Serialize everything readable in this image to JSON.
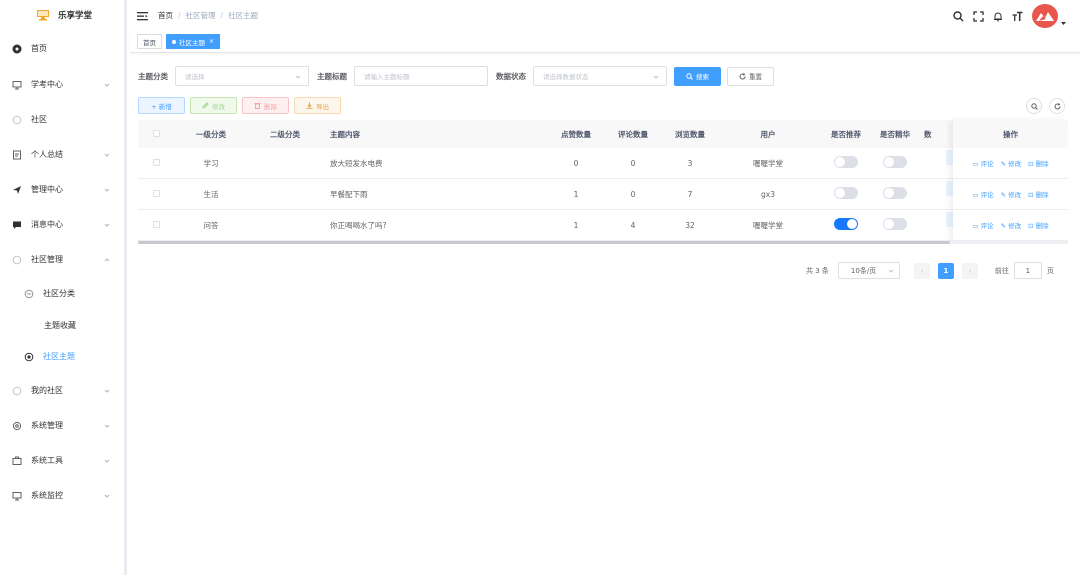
{
  "app": {
    "title": "乐享学堂"
  },
  "sidebar": {
    "items": [
      {
        "label": "首页",
        "icon": "dashboard-icon"
      },
      {
        "label": "学考中心",
        "icon": "monitor-icon"
      },
      {
        "label": "社区",
        "icon": "circle-icon"
      },
      {
        "label": "个人总结",
        "icon": "document-icon"
      },
      {
        "label": "管理中心",
        "icon": "send-icon"
      },
      {
        "label": "消息中心",
        "icon": "message-icon"
      },
      {
        "label": "社区管理",
        "icon": "circle-icon"
      },
      {
        "label": "社区分类",
        "icon": "folder-icon"
      },
      {
        "label": "主题收藏",
        "icon": ""
      },
      {
        "label": "社区主题",
        "icon": "target-icon"
      },
      {
        "label": "我的社区",
        "icon": "circle-icon"
      },
      {
        "label": "系统管理",
        "icon": "settings-icon"
      },
      {
        "label": "系统工具",
        "icon": "tool-icon"
      },
      {
        "label": "系统监控",
        "icon": "monitor-icon"
      }
    ]
  },
  "header": {
    "breadcrumb": [
      "首页",
      "社区管理",
      "社区主题"
    ]
  },
  "tags": [
    {
      "label": "首页"
    },
    {
      "label": "社区主题"
    }
  ],
  "form": {
    "category_label": "主题分类",
    "category_placeholder": "请选择",
    "title_label": "主题标题",
    "title_placeholder": "请输入主题标题",
    "status_label": "数据状态",
    "status_placeholder": "请选择数据状态",
    "search_btn": "搜索",
    "reset_btn": "重置"
  },
  "toolbar": {
    "add": "+ 新增",
    "edit": "修改",
    "delete": "删除",
    "export": "导出"
  },
  "table": {
    "headers": {
      "cat1": "一级分类",
      "cat2": "二级分类",
      "content": "主题内容",
      "likes": "点赞数量",
      "comments": "评论数量",
      "views": "浏览数量",
      "user": "用户",
      "recommend": "是否推荐",
      "featured": "是否精华",
      "clipped": "数",
      "ops": "操作"
    },
    "rows": [
      {
        "cat1": "学习",
        "cat2": "",
        "content": "放大短发水电费",
        "likes": "0",
        "comments": "0",
        "views": "3",
        "user": "喔喔学堂",
        "recommend": false,
        "featured": false
      },
      {
        "cat1": "生活",
        "cat2": "",
        "content": "早餐配下雨",
        "likes": "1",
        "comments": "0",
        "views": "7",
        "user": "gx3",
        "recommend": false,
        "featured": false
      },
      {
        "cat1": "问答",
        "cat2": "",
        "content": "你正喝喝水了吗?",
        "likes": "1",
        "comments": "4",
        "views": "32",
        "user": "喔喔学堂",
        "recommend": true,
        "featured": false
      }
    ],
    "op_comment": "评论",
    "op_edit": "修改",
    "op_delete": "删除"
  },
  "pager": {
    "total": "共 3 条",
    "page_size": "10条/页",
    "current": "1",
    "goto_label": "前往",
    "goto_value": "1",
    "page_unit": "页"
  },
  "colors": {
    "primary": "#409eff",
    "switch_on": "#1677ff",
    "avatar": "#e8574e"
  }
}
